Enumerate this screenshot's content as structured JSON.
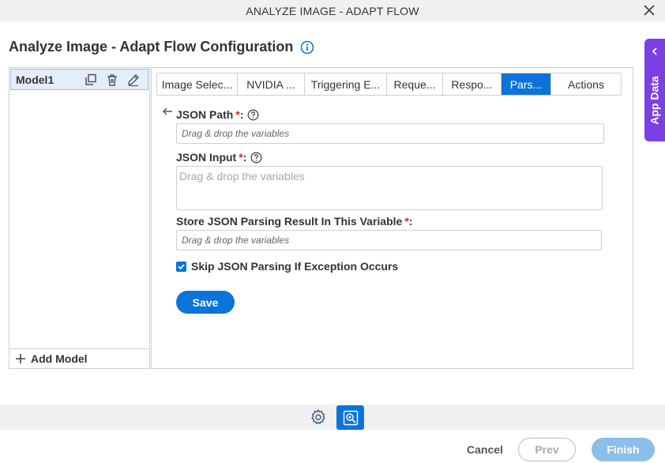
{
  "window": {
    "title": "ANALYZE IMAGE - ADAPT FLOW"
  },
  "page": {
    "title": "Analyze Image - Adapt Flow Configuration"
  },
  "app_data": {
    "label": "App Data"
  },
  "models": {
    "items": [
      {
        "label": "Model1"
      }
    ],
    "add_label": "Add Model"
  },
  "tabs": [
    {
      "label": "Image Selec..."
    },
    {
      "label": "NVIDIA ..."
    },
    {
      "label": "Triggering E..."
    },
    {
      "label": "Reque..."
    },
    {
      "label": "Respo..."
    },
    {
      "label": "Pars...",
      "active": true
    },
    {
      "label": "Actions"
    }
  ],
  "form": {
    "json_path": {
      "label": "JSON Path",
      "required_mark": "*",
      "colon": ":",
      "placeholder": "Drag & drop the variables"
    },
    "json_input": {
      "label": "JSON Input",
      "required_mark": "*",
      "colon": ":",
      "placeholder": "Drag & drop the variables"
    },
    "store_result": {
      "label": "Store JSON Parsing Result In This Variable",
      "required_mark": "*",
      "colon": ":",
      "placeholder": "Drag & drop the variables"
    },
    "skip_exception": {
      "label": "Skip JSON Parsing If Exception Occurs",
      "checked": true
    },
    "save_label": "Save"
  },
  "footer": {
    "cancel": "Cancel",
    "prev": "Prev",
    "finish": "Finish"
  },
  "colors": {
    "primary": "#0b74da",
    "app_data_tab": "#7b3fe4",
    "required": "#d62828",
    "finish_disabled": "#8bbfe9"
  },
  "icons": [
    "close-icon",
    "info-icon",
    "chevron-left-icon",
    "copy-icon",
    "delete-icon",
    "edit-icon",
    "plus-icon",
    "back-arrow-icon",
    "help-icon",
    "check-icon",
    "gear-icon",
    "image-analyze-icon"
  ]
}
